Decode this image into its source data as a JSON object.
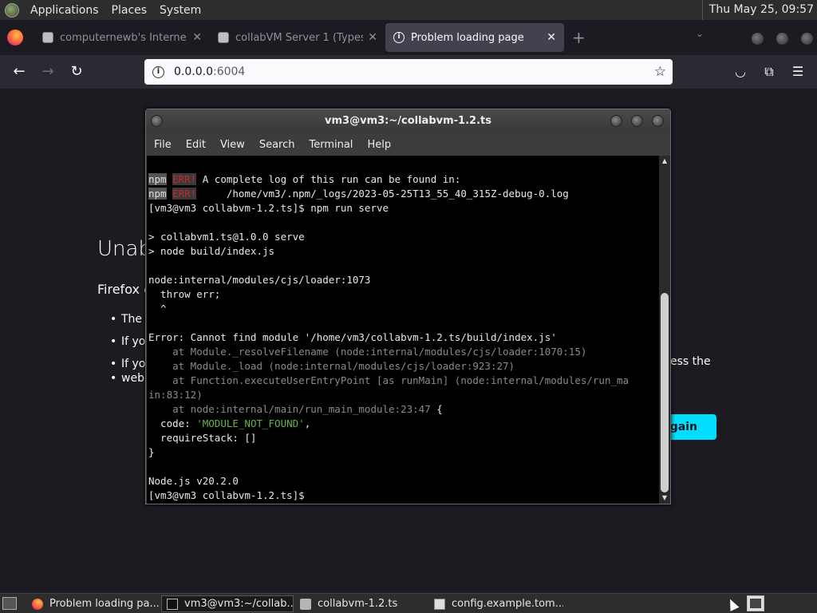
{
  "top_panel": {
    "menus": [
      "Applications",
      "Places",
      "System"
    ],
    "clock": "Thu May 25, 09:57"
  },
  "browser": {
    "tabs": [
      {
        "label": "computernewb's Interne",
        "active": false
      },
      {
        "label": "collabVM Server 1 (Types",
        "active": false
      },
      {
        "label": "Problem loading page",
        "active": true
      }
    ],
    "new_tab": "+",
    "url_host": "0.0.0.0",
    "url_port": ":6004"
  },
  "error_page": {
    "title": "Unab",
    "subtitle": "Firefox c",
    "bullets": [
      "The s",
      "If you",
      "If you",
      "web"
    ],
    "tail_text": "ess the",
    "button_label": "Again"
  },
  "terminal": {
    "title": "vm3@vm3:~/collabvm-1.2.ts",
    "menu": [
      "File",
      "Edit",
      "View",
      "Search",
      "Terminal",
      "Help"
    ],
    "npm_tag": "npm",
    "err_tag": "ERR!",
    "lines": [
      {
        "text": " A complete log of this run can be found in:"
      },
      {
        "text": "     /home/vm3/.npm/_logs/2023-05-25T13_55_40_315Z-debug-0.log"
      },
      {
        "text": "[vm3@vm3 collabvm-1.2.ts]$ npm run serve"
      },
      {
        "text": ""
      },
      {
        "text": "> collabvm1.ts@1.0.0 serve"
      },
      {
        "text": "> node build/index.js"
      },
      {
        "text": ""
      },
      {
        "text": "node:internal/modules/cjs/loader:1073"
      },
      {
        "text": "  throw err;"
      },
      {
        "text": "  ^"
      },
      {
        "text": ""
      },
      {
        "text": "Error: Cannot find module '/home/vm3/collabvm-1.2.ts/build/index.js'"
      },
      {
        "text": "    at Module._resolveFilename (node:internal/modules/cjs/loader:1070:15)"
      },
      {
        "text": "    at Module._load (node:internal/modules/cjs/loader:923:27)"
      },
      {
        "text": "    at Function.executeUserEntryPoint [as runMain] (node:internal/modules/run_ma"
      },
      {
        "text": "in:83:12)"
      },
      {
        "text": "    at node:internal/main/run_main_module:23:47"
      },
      {
        "text": " {"
      },
      {
        "text": "  code: "
      },
      {
        "text": "'MODULE_NOT_FOUND'"
      },
      {
        "text": ","
      },
      {
        "text": "  requireStack: []"
      },
      {
        "text": "}"
      },
      {
        "text": ""
      },
      {
        "text": "Node.js v20.2.0"
      },
      {
        "text": "[vm3@vm3 collabvm-1.2.ts]$ "
      }
    ]
  },
  "taskbar": {
    "tasks": [
      {
        "label": "Problem loading pa...",
        "icon": "firefox-icon"
      },
      {
        "label": "vm3@vm3:~/collab...",
        "icon": "terminal-icon"
      },
      {
        "label": "collabvm-1.2.ts",
        "icon": "folder-icon"
      },
      {
        "label": "config.example.tom...",
        "icon": "text-editor-icon"
      }
    ]
  }
}
